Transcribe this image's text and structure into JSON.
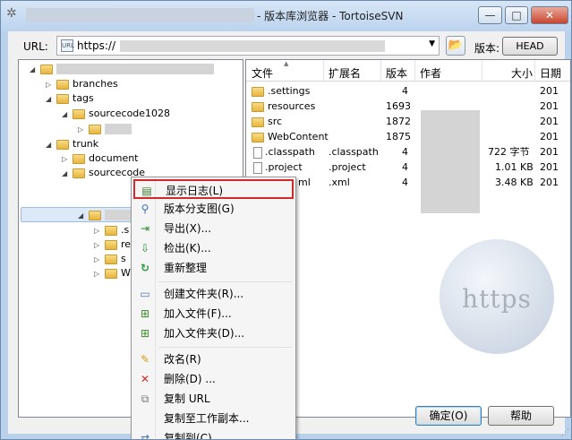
{
  "window": {
    "title": "- 版本库浏览器 - TortoiseSVN",
    "minimize": "—",
    "maximize": "□",
    "close": "✕"
  },
  "toolbar": {
    "url_label": "URL:",
    "url_value": "https://",
    "version_label": "版本:",
    "head_button": "HEAD"
  },
  "tree": {
    "items": [
      {
        "label": "branches"
      },
      {
        "label": "tags"
      },
      {
        "label": "sourcecode1028"
      },
      {
        "label": "trunk"
      },
      {
        "label": "document"
      },
      {
        "label": "sourcecode"
      }
    ],
    "partial_labels": [
      ".s",
      "re",
      "s",
      "W"
    ]
  },
  "list": {
    "columns": [
      "文件",
      "扩展名",
      "版本",
      "作者",
      "大小",
      "日期"
    ],
    "rows": [
      {
        "name": ".settings",
        "ext": "",
        "rev": "4",
        "size": "",
        "date": "201"
      },
      {
        "name": "resources",
        "ext": "",
        "rev": "1693",
        "size": "",
        "date": "201"
      },
      {
        "name": "src",
        "ext": "",
        "rev": "1872",
        "size": "",
        "date": "201"
      },
      {
        "name": "WebContent",
        "ext": "",
        "rev": "1875",
        "size": "",
        "date": "201"
      },
      {
        "name": ".classpath",
        "ext": ".classpath",
        "rev": "4",
        "size": "722 字节",
        "date": "201"
      },
      {
        "name": ".project",
        "ext": ".project",
        "rev": "4",
        "size": "1.01 KB",
        "date": "201"
      },
      {
        "name": "ml",
        "ext": ".xml",
        "rev": "4",
        "size": "3.48 KB",
        "date": "201"
      }
    ]
  },
  "context_menu": {
    "items": [
      {
        "label": "显示日志(L)",
        "icon": "log-icon"
      },
      {
        "label": "版本分支图(G)",
        "icon": "graph-icon"
      },
      {
        "label": "导出(X)...",
        "icon": "export-icon"
      },
      {
        "label": "检出(K)...",
        "icon": "checkout-icon"
      },
      {
        "label": "重新整理",
        "icon": "refresh-icon"
      },
      {
        "label": "创建文件夹(R)...",
        "icon": "new-folder-icon"
      },
      {
        "label": "加入文件(F)...",
        "icon": "add-file-icon"
      },
      {
        "label": "加入文件夹(D)...",
        "icon": "add-folder-icon"
      },
      {
        "label": "改名(R)",
        "icon": "rename-icon"
      },
      {
        "label": "删除(D) ...",
        "icon": "delete-icon"
      },
      {
        "label": "复制 URL",
        "icon": "copy-url-icon"
      },
      {
        "label": "复制至工作副本...",
        "icon": ""
      },
      {
        "label": "复制到(C)...",
        "icon": "copy-to-icon"
      }
    ]
  },
  "buttons": {
    "ok": "确定(O)",
    "help": "帮助"
  },
  "watermark": {
    "text": "https"
  },
  "colors": {
    "highlight_border": "#d22a2a",
    "selection": "#dce9f8"
  }
}
